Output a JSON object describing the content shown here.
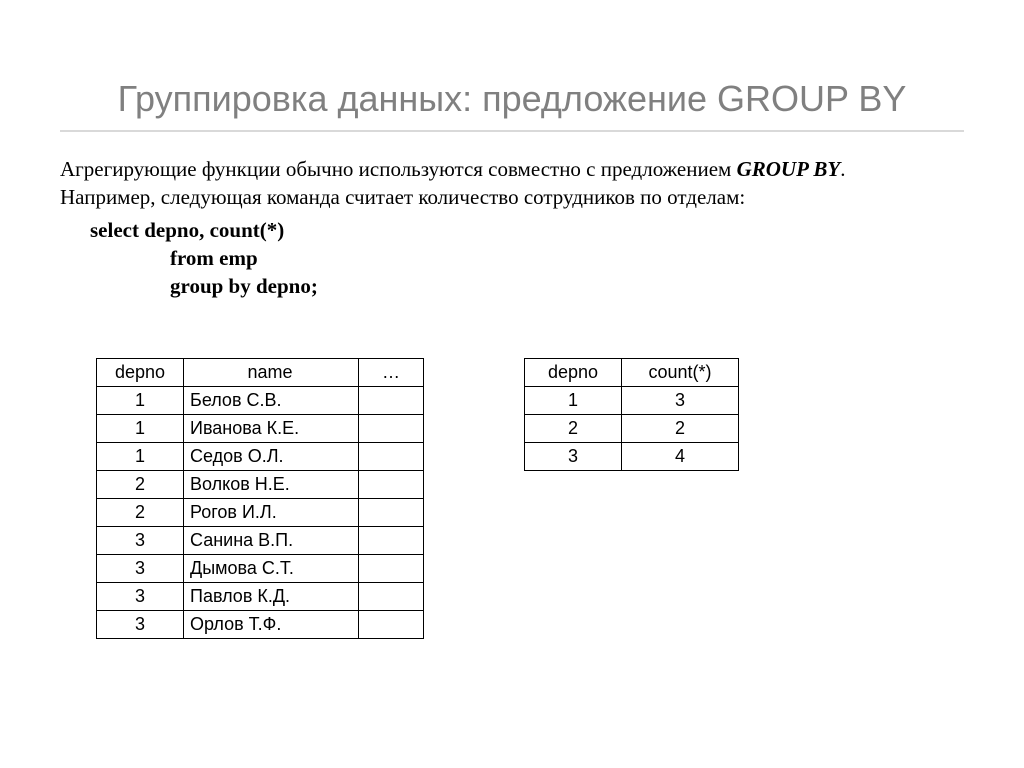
{
  "title": "Группировка данных: предложение GROUP BY",
  "para": {
    "line1a": "Агрегирующие функции обычно используются совместно с предложением ",
    "line1b": "GROUP BY",
    "line1c": ".",
    "line2": "Например, следующая команда считает количество сотрудников по отделам:"
  },
  "sql": {
    "l1": "select  depno,  count(*)",
    "l2": "from emp",
    "l3": "group by depno;"
  },
  "table1": {
    "headers": {
      "depno": "depno",
      "name": "name",
      "etc": "…"
    },
    "rows": [
      {
        "depno": "1",
        "name": "Белов С.В."
      },
      {
        "depno": "1",
        "name": "Иванова К.Е."
      },
      {
        "depno": "1",
        "name": "Седов О.Л."
      },
      {
        "depno": "2",
        "name": "Волков Н.Е."
      },
      {
        "depno": "2",
        "name": "Рогов И.Л."
      },
      {
        "depno": "3",
        "name": "Санина В.П."
      },
      {
        "depno": "3",
        "name": "Дымова С.Т."
      },
      {
        "depno": "3",
        "name": "Павлов К.Д."
      },
      {
        "depno": "3",
        "name": "Орлов Т.Ф."
      }
    ]
  },
  "table2": {
    "headers": {
      "depno": "depno",
      "count": "count(*)"
    },
    "rows": [
      {
        "depno": "1",
        "count": "3"
      },
      {
        "depno": "2",
        "count": "2"
      },
      {
        "depno": "3",
        "count": "4"
      }
    ]
  }
}
